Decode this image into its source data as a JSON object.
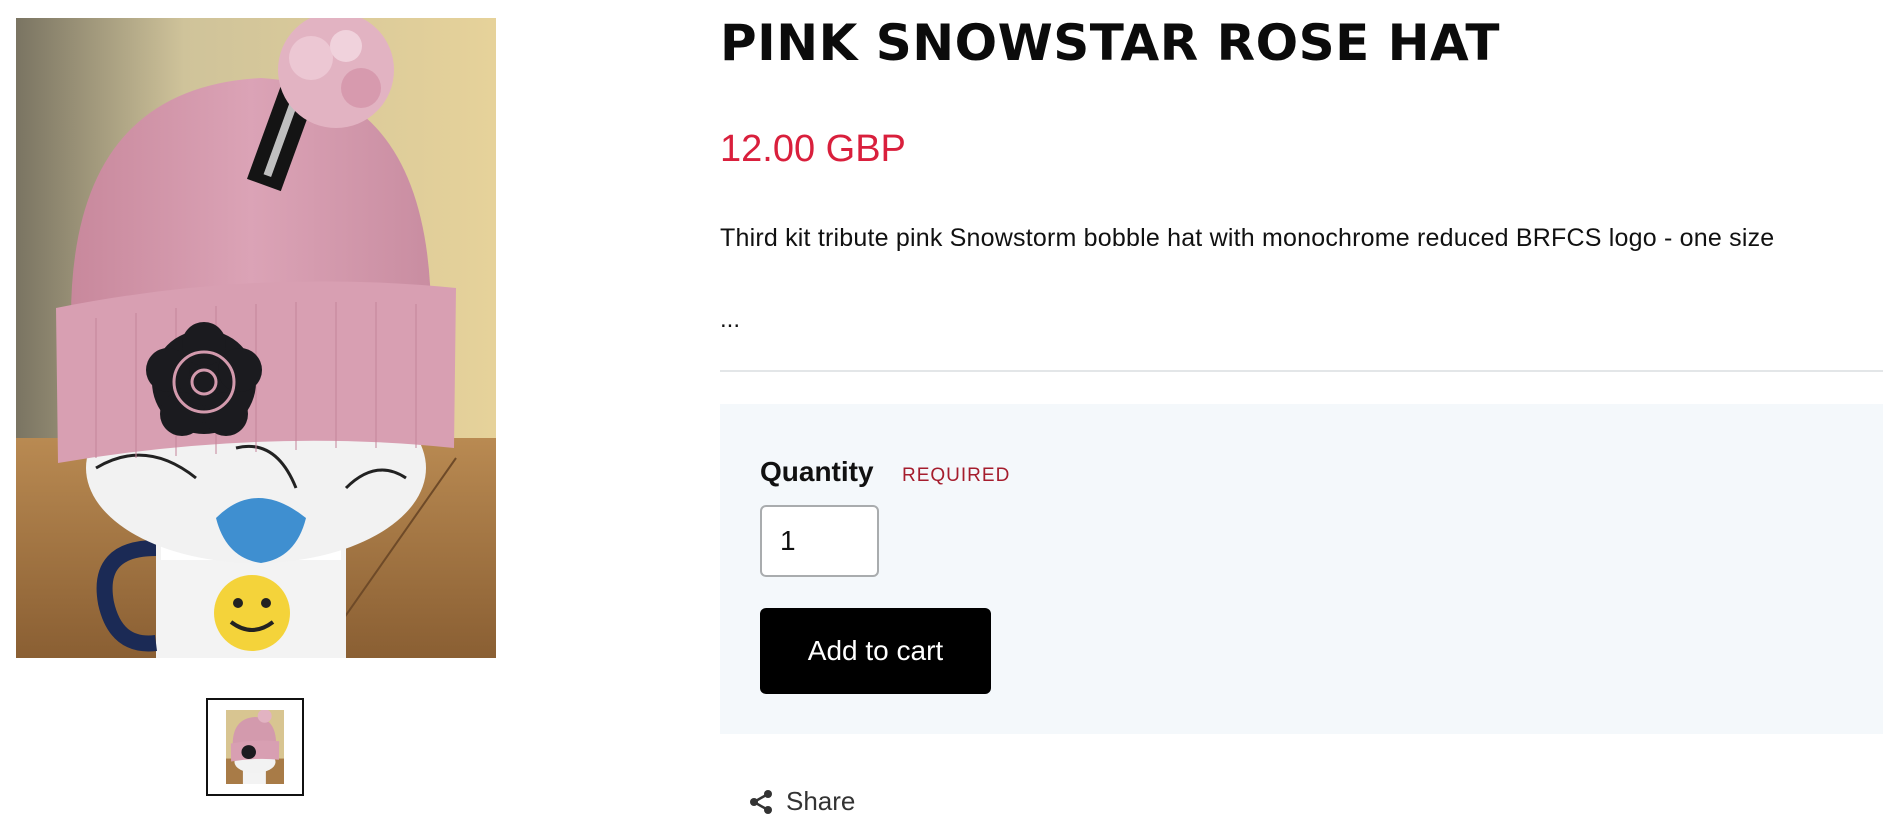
{
  "product": {
    "title": "PINK SNOWSTAR ROSE HAT",
    "price": "12.00 GBP",
    "description": "Third kit tribute pink Snowstorm bobble hat with monochrome reduced BRFCS logo - one size",
    "description_more": "..."
  },
  "gallery": {
    "main_image_icon": "product-photo",
    "thumbnail_count": 1
  },
  "purchase": {
    "quantity_label": "Quantity",
    "required_label": "REQUIRED",
    "quantity_value": "1",
    "add_to_cart_label": "Add to cart"
  },
  "share": {
    "label": "Share",
    "icon": "share-icon"
  },
  "colors": {
    "price": "#d91f3c",
    "required": "#a51d2d",
    "panel_background": "#f4f8fb",
    "button_background": "#000000",
    "hat_pink": "#d39aad"
  }
}
